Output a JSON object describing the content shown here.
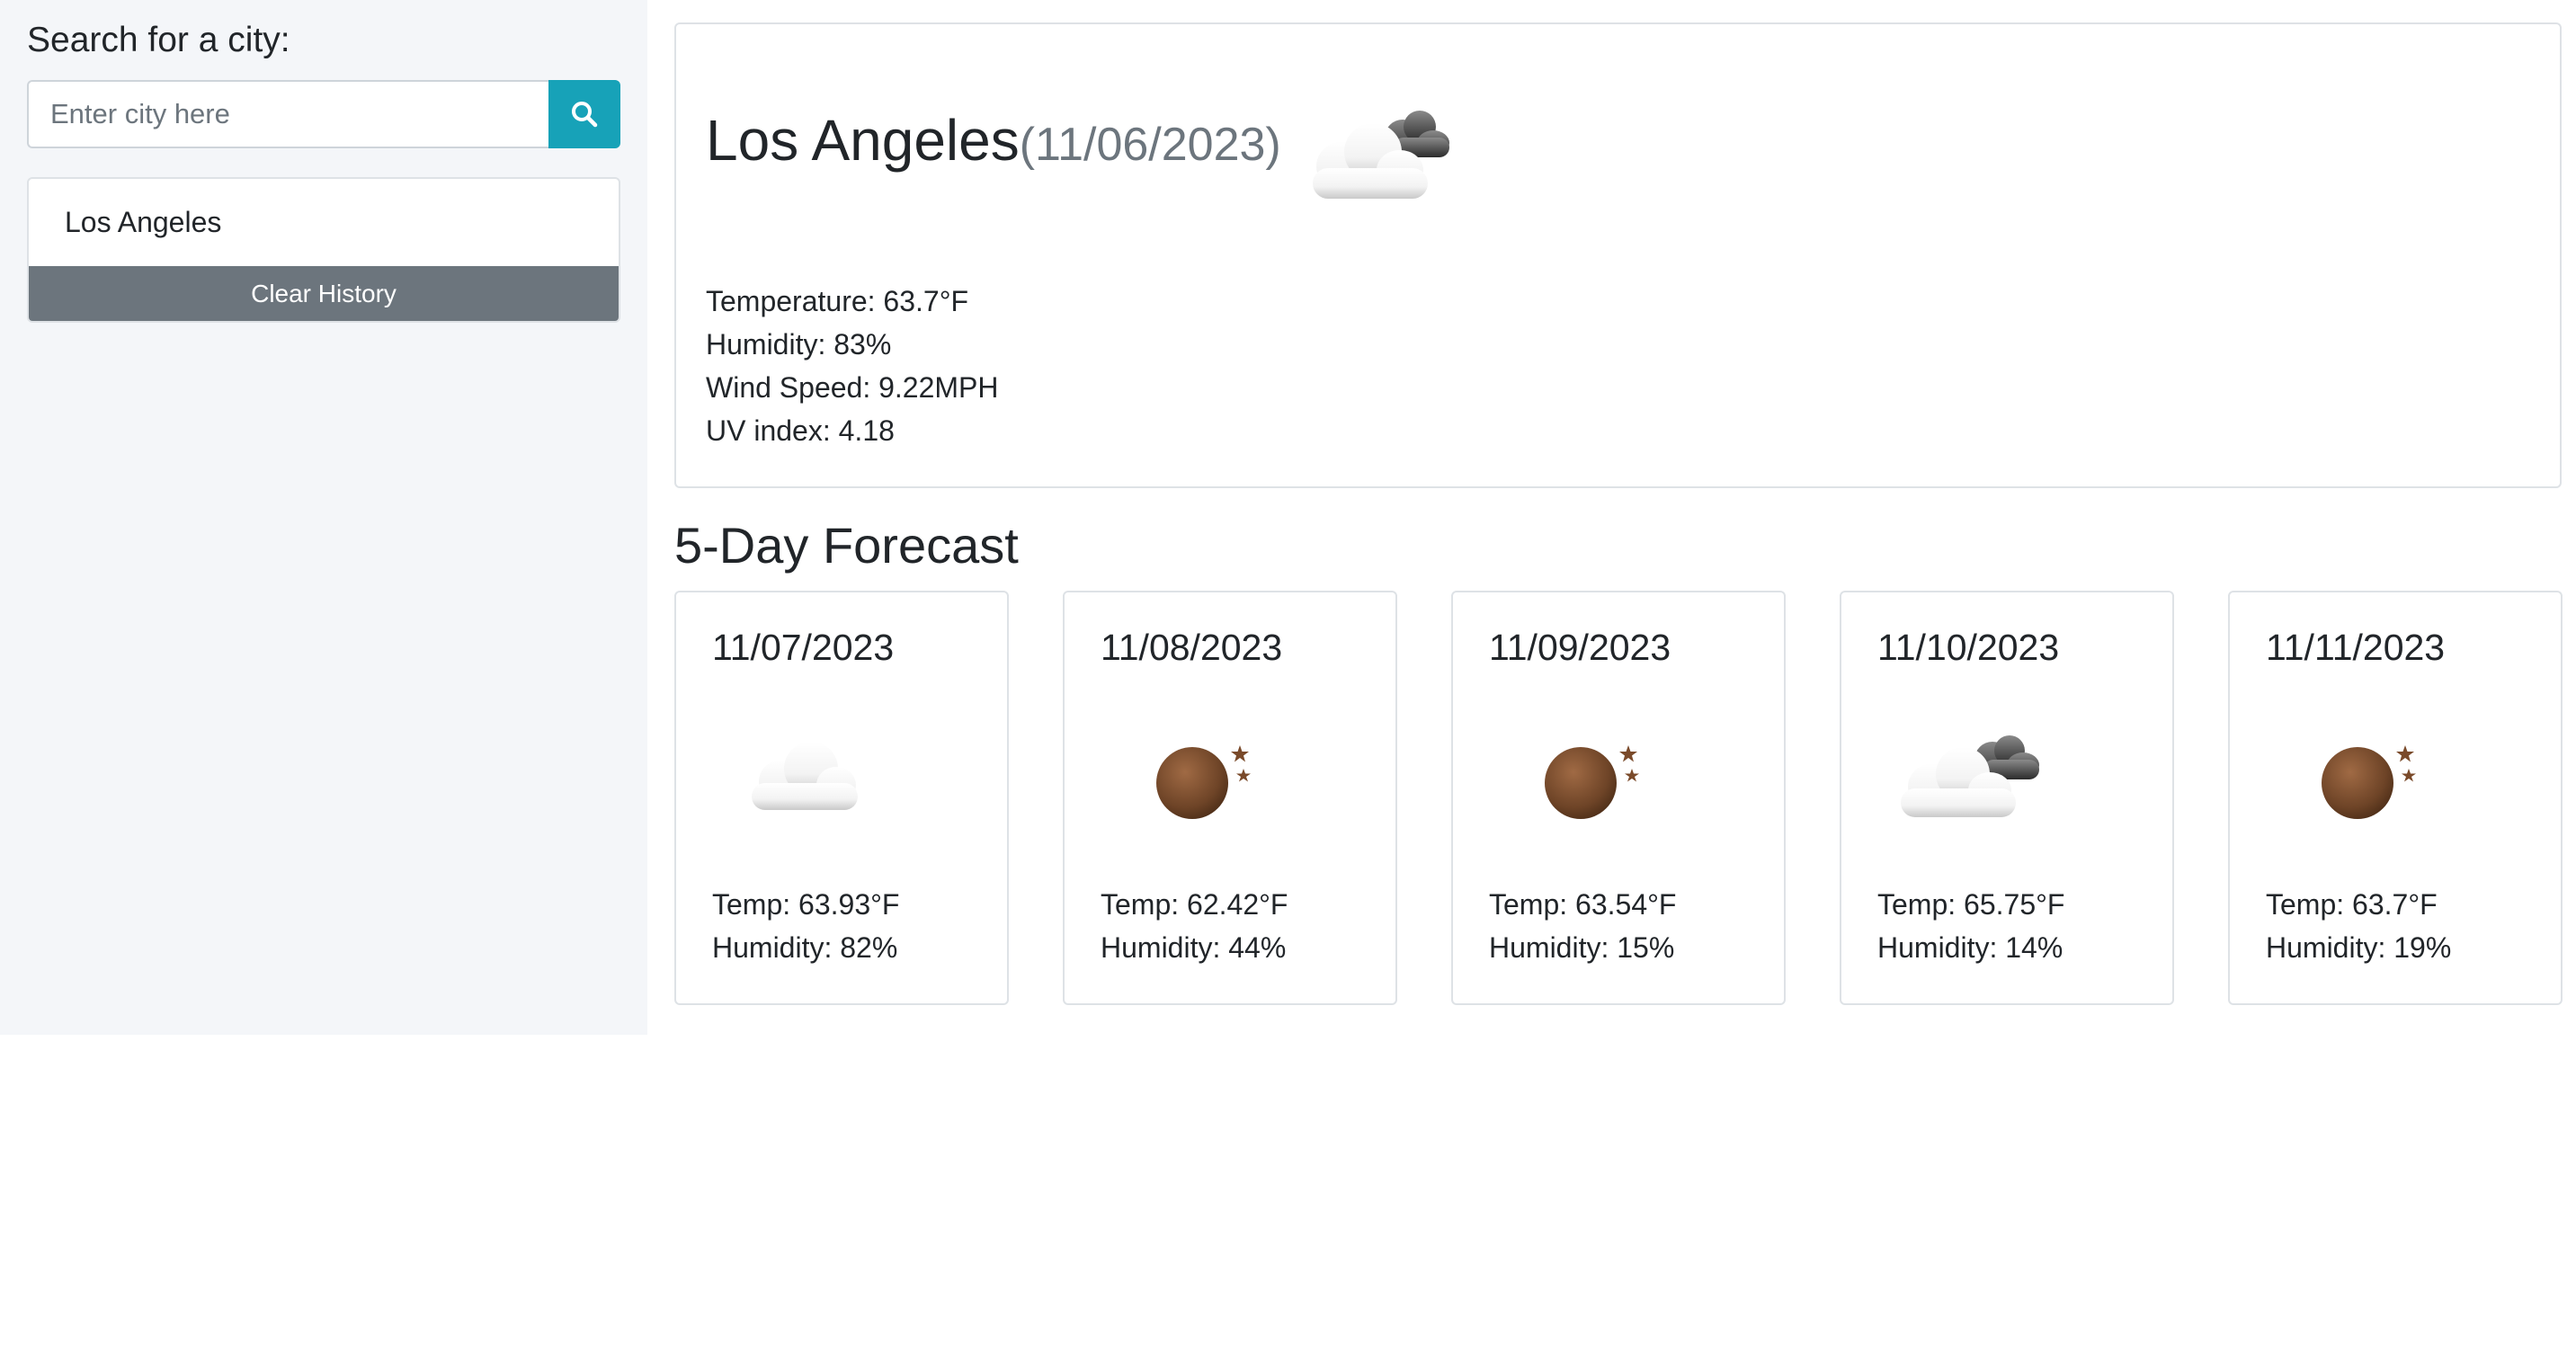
{
  "sidebar": {
    "heading": "Search for a city:",
    "search": {
      "placeholder": "Enter city here",
      "value": "",
      "button_icon": "search-icon"
    },
    "history": [
      "Los Angeles"
    ],
    "clear_label": "Clear History"
  },
  "current": {
    "city": "Los Angeles",
    "date": "(11/06/2023)",
    "icon": "partly-cloudy-icon",
    "temperature": "Temperature: 63.7°F",
    "humidity": "Humidity: 83%",
    "wind": "Wind Speed: 9.22MPH",
    "uv": "UV index: 4.18"
  },
  "forecast": {
    "heading": "5-Day Forecast",
    "days": [
      {
        "date": "11/07/2023",
        "icon": "cloud-icon",
        "temp": "Temp: 63.93°F",
        "humidity": "Humidity: 82%"
      },
      {
        "date": "11/08/2023",
        "icon": "moon-stars-icon",
        "temp": "Temp: 62.42°F",
        "humidity": "Humidity: 44%"
      },
      {
        "date": "11/09/2023",
        "icon": "moon-stars-icon",
        "temp": "Temp: 63.54°F",
        "humidity": "Humidity: 15%"
      },
      {
        "date": "11/10/2023",
        "icon": "partly-cloudy-icon",
        "temp": "Temp: 65.75°F",
        "humidity": "Humidity: 14%"
      },
      {
        "date": "11/11/2023",
        "icon": "moon-stars-icon",
        "temp": "Temp: 63.7°F",
        "humidity": "Humidity: 19%"
      }
    ]
  },
  "colors": {
    "accent": "#17a2b8",
    "secondary": "#6c757d",
    "sidebar_bg": "#f4f6f9"
  }
}
